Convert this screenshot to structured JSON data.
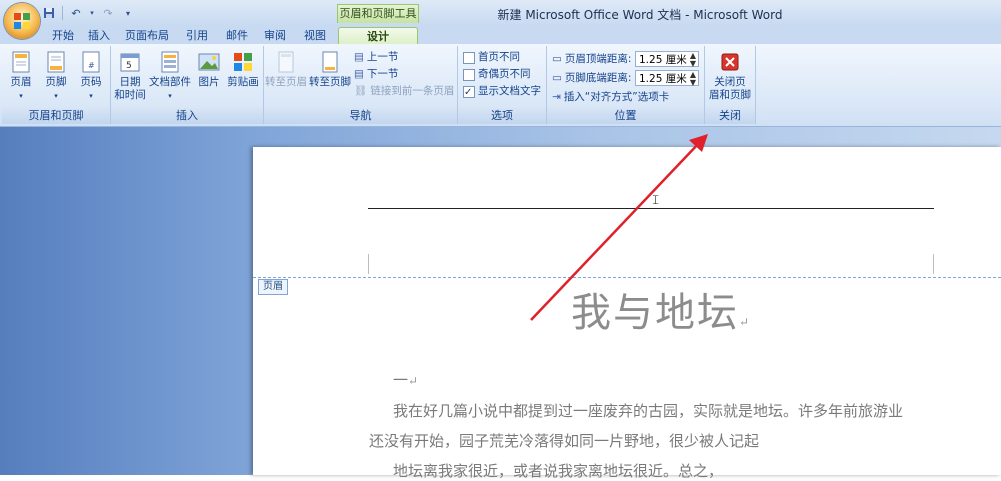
{
  "window": {
    "title": "新建 Microsoft Office Word 文档 - Microsoft Word",
    "context_tool": "页眉和页脚工具"
  },
  "quick_access": {
    "save_icon": "floppy-disk-icon",
    "undo_icon": "undo-icon",
    "redo_icon": "redo-icon",
    "customize_icon": "chevron-down-icon"
  },
  "tabs": [
    {
      "label": "开始"
    },
    {
      "label": "插入"
    },
    {
      "label": "页面布局"
    },
    {
      "label": "引用"
    },
    {
      "label": "邮件"
    },
    {
      "label": "审阅"
    },
    {
      "label": "视图"
    },
    {
      "label": "设计",
      "active": true
    }
  ],
  "groups": {
    "header_footer": {
      "label": "页眉和页脚",
      "header": "页眉",
      "footer": "页脚",
      "page_number": "页码"
    },
    "insert": {
      "label": "插入",
      "date_time_line1": "日期",
      "date_time_line2": "和时间",
      "quick_parts": "文档部件",
      "picture": "图片",
      "clip_art": "剪贴画"
    },
    "navigation": {
      "label": "导航",
      "goto_header": "转至页眉",
      "goto_footer": "转至页脚",
      "previous": "上一节",
      "next": "下一节",
      "link_previous": "链接到前一条页眉"
    },
    "options": {
      "label": "选项",
      "different_first": "首页不同",
      "different_odd_even": "奇偶页不同",
      "show_doc_text": "显示文档文字"
    },
    "position": {
      "label": "位置",
      "header_from_top": "页眉顶端距离:",
      "header_from_top_value": "1.25 厘米",
      "footer_from_bottom": "页脚底端距离:",
      "footer_from_bottom_value": "1.25 厘米",
      "insert_align_tab": "插入“对齐方式”选项卡"
    },
    "close": {
      "label": "关闭",
      "close_line1": "关闭页",
      "close_line2": "眉和页脚"
    }
  },
  "document": {
    "header_tag": "页眉",
    "title": "我与地坛",
    "para_mark": "↵",
    "section_number": "一",
    "lines": [
      "我在好几篇小说中都提到过一座废弃的古园，实际就是地坛。许多年前旅游业",
      "还没有开始，园子荒芜冷落得如同一片野地，很少被人记起",
      "地坛离我家很近，或者说我家离地坛很近。总之，"
    ]
  },
  "colors": {
    "annotation_arrow": "#e0202a",
    "accent": "#15428b",
    "context_tab": "#c6e3a1"
  }
}
